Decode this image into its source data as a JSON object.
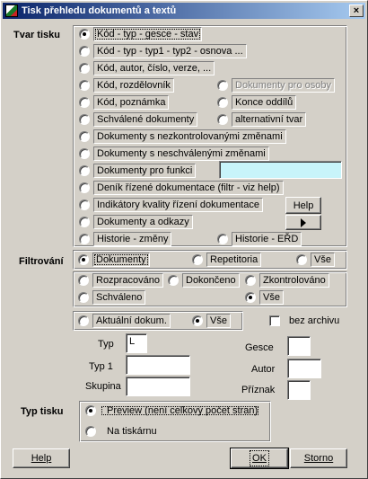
{
  "window": {
    "title": "Tisk přehledu dokumentů a textů",
    "close_glyph": "×"
  },
  "tvar_tisku": {
    "label": "Tvar tisku",
    "options": [
      "Kód - typ - gesce - stav",
      "Kód - typ - typ1 - typ2 - osnova ...",
      "Kód, autor, číslo, verze, ...",
      "Kód, rozdělovník",
      "Kód, poznámka",
      "Schválené dokumenty",
      "Dokumenty s nezkontrolovanými změnami",
      "Dokumenty s neschválenými změnami",
      "Dokumenty pro funkci",
      "Deník řízené dokumentace (filtr - viz help)",
      "Indikátory kvality řízení dokumentace",
      "Dokumenty a odkazy",
      "Historie - změny"
    ],
    "right_options": [
      "Dokumenty pro osoby",
      "Konce oddílů",
      "alternativní tvar",
      "Historie - EŘD"
    ],
    "pro_funkci_value": "",
    "help_button": "Help",
    "arrow_button_icon": "play-arrow-icon"
  },
  "filtrovani": {
    "label": "Filtrování",
    "typ": [
      "Dokumenty",
      "Repetitoria",
      "Vše"
    ],
    "stav": [
      "Rozpracováno",
      "Dokončeno",
      "Zkontrolováno",
      "Schváleno",
      "Vše"
    ],
    "aktualni": [
      "Aktuální dokum.",
      "Vše"
    ],
    "bez_archivu": "bez archivu"
  },
  "fields": {
    "typ_label": "Typ",
    "typ_value": "L",
    "typ1_label": "Typ 1",
    "typ1_value": "",
    "skupina_label": "Skupina",
    "skupina_value": "",
    "gesce_label": "Gesce",
    "gesce_value": "",
    "autor_label": "Autor",
    "autor_value": "",
    "priznak_label": "Příznak",
    "priznak_value": ""
  },
  "typ_tisku": {
    "label": "Typ tisku",
    "options": [
      "Preview (není celkový počet stran)",
      "Na tiskárnu"
    ]
  },
  "buttons": {
    "help": "Help",
    "ok": "OK",
    "storno": "Storno"
  },
  "colors": {
    "face": "#d4d0c8",
    "title_start": "#0a246a",
    "title_end": "#a6caf0",
    "highlight_field": "#c8f4fa"
  }
}
